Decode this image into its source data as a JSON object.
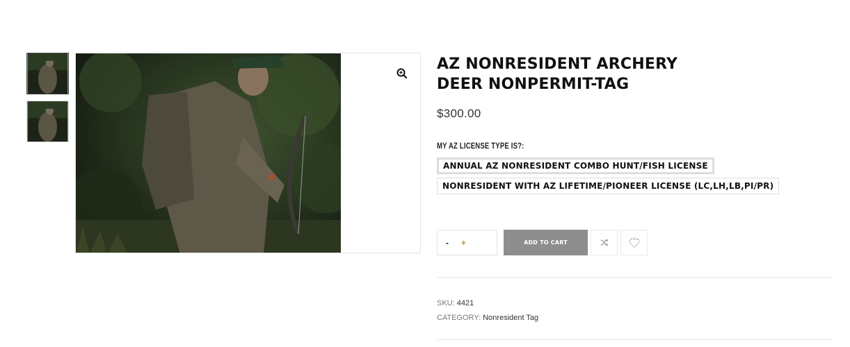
{
  "product": {
    "title": "AZ NONRESIDENT ARCHERY DEER NONPERMIT-TAG",
    "price": "$300.00",
    "attribute_label": "MY AZ LICENSE TYPE IS?:",
    "options": [
      {
        "label": "ANNUAL AZ NONRESIDENT COMBO HUNT/FISH LICENSE",
        "selected": true
      },
      {
        "label": "NONRESIDENT WITH AZ LIFETIME/PIONEER LICENSE (LC,LH,LB,PI/PR)",
        "selected": false
      }
    ]
  },
  "cart": {
    "minus": "-",
    "plus": "+",
    "add_to_cart": "ADD TO CART"
  },
  "meta": {
    "sku_label": "SKU:",
    "sku_value": "4421",
    "category_label": "CATEGORY:",
    "category_value": "Nonresident Tag"
  },
  "icons": {
    "zoom": "zoom-in-icon",
    "compare": "shuffle-icon",
    "wishlist": "heart-icon"
  },
  "colors": {
    "add_to_cart_bg": "#8d8d8d",
    "title": "#111111",
    "plus_accent": "#c88a2a"
  }
}
